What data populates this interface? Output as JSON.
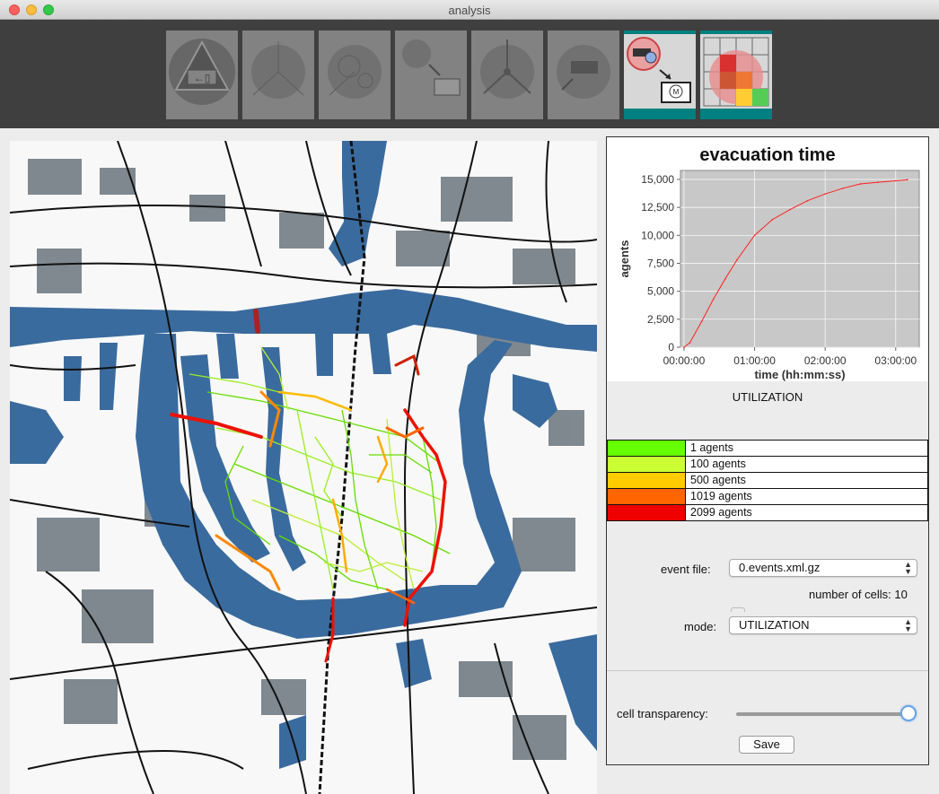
{
  "window": {
    "title": "analysis"
  },
  "toolbar": {
    "tools": [
      {
        "icon": "evacuation-exit-icon",
        "state": "inactive"
      },
      {
        "icon": "network-nodes-icon",
        "state": "inactive"
      },
      {
        "icon": "node-links-icon",
        "state": "inactive"
      },
      {
        "icon": "export-to-monitor-icon",
        "state": "inactive"
      },
      {
        "icon": "connected-nodes-icon",
        "state": "inactive"
      },
      {
        "icon": "bus-routing-icon",
        "state": "inactive"
      },
      {
        "icon": "transit-to-monitor-icon",
        "state": "active"
      },
      {
        "icon": "grid-heatmap-icon",
        "state": "active"
      }
    ],
    "monitor_letter": "M"
  },
  "chart_data": {
    "type": "line",
    "title": "evacuation time",
    "xlabel": "time (hh:mm:ss)",
    "ylabel": "agents",
    "x_ticks": [
      "00:00:00",
      "01:00:00",
      "02:00:00",
      "03:00:00"
    ],
    "y_ticks": [
      "0",
      "2,500",
      "5,000",
      "7,500",
      "10,000",
      "12,500",
      "15,000"
    ],
    "xlim_minutes": [
      -3,
      200
    ],
    "ylim": [
      0,
      15800
    ],
    "line_color": "#ff2020",
    "background": "#c8c8c8",
    "grid": true,
    "series": [
      {
        "x_minutes": [
          0,
          5,
          15,
          25,
          35,
          45,
          60,
          75,
          90,
          105,
          120,
          135,
          150,
          165,
          180,
          190
        ],
        "values": [
          0,
          400,
          2300,
          4300,
          6100,
          7800,
          10000,
          11400,
          12300,
          13100,
          13700,
          14200,
          14600,
          14750,
          14880,
          14980
        ]
      }
    ]
  },
  "utilization": {
    "title": "UTILIZATION",
    "legend": [
      {
        "color": "#66ff00",
        "label": "1 agents"
      },
      {
        "color": "#ccff33",
        "label": "100 agents"
      },
      {
        "color": "#ffcc00",
        "label": "500 agents"
      },
      {
        "color": "#ff6600",
        "label": "1019 agents"
      },
      {
        "color": "#ee0000",
        "label": "2099 agents"
      }
    ]
  },
  "controls": {
    "event_file_label": "event file:",
    "event_file_value": "0.events.xml.gz",
    "cells_label": "number of cells: 10",
    "mode_label": "mode:",
    "mode_value": "UTILIZATION",
    "transparency_label": "cell transparency:",
    "transparency_level": 1.0,
    "save_label": "Save"
  },
  "map": {
    "water_color": "#3a6b9e",
    "road_color": "#111111",
    "building_color": "#1d2d38"
  }
}
